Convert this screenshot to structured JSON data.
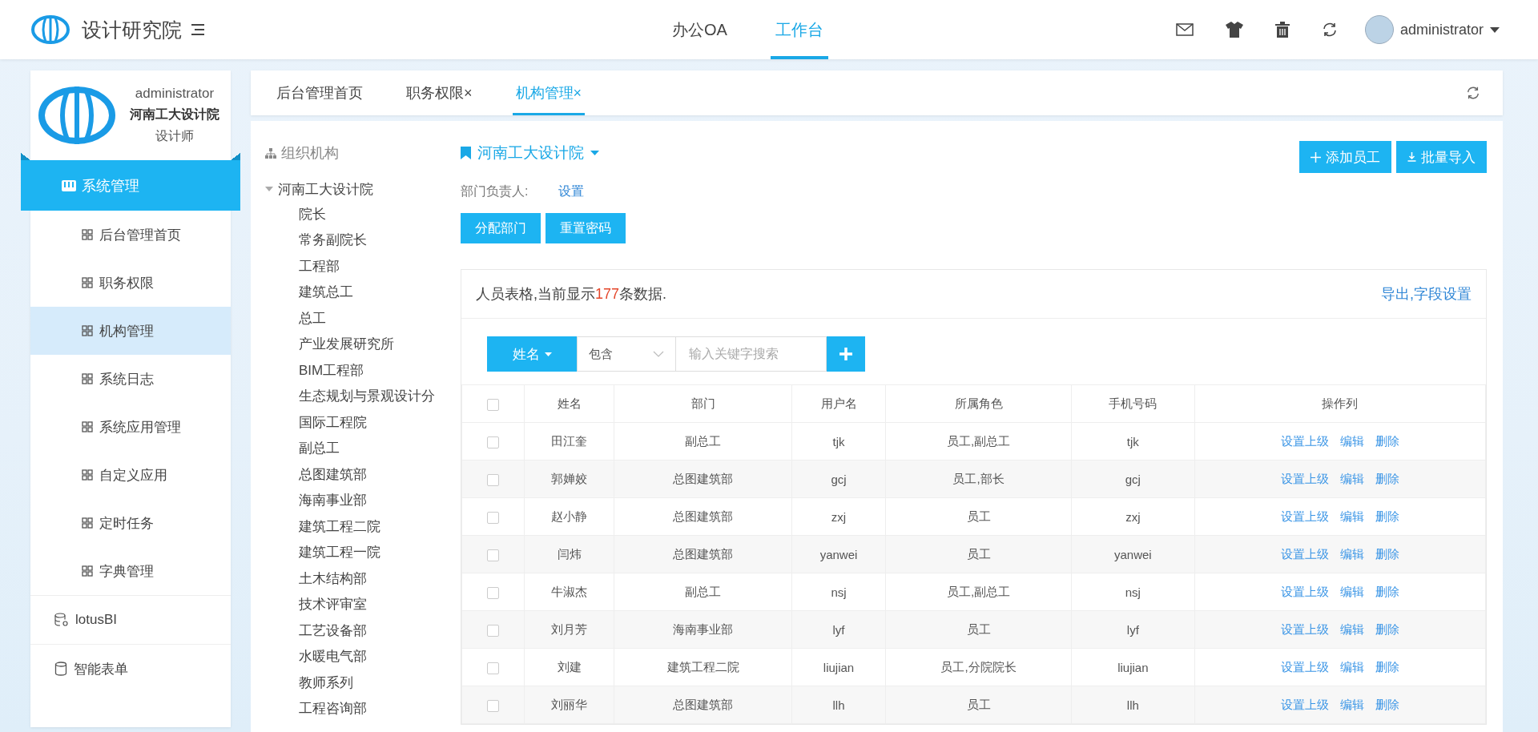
{
  "header": {
    "title": "设计研究院",
    "nav": [
      {
        "label": "办公OA",
        "selected": false
      },
      {
        "label": "工作台",
        "selected": true
      }
    ],
    "user": "administrator"
  },
  "sidebar": {
    "profile": {
      "name": "administrator",
      "org": "河南工大设计院",
      "role": "设计师"
    },
    "items": [
      {
        "label": "系统管理",
        "kind": "section",
        "selected": false
      },
      {
        "label": "后台管理首页",
        "kind": "item",
        "selected": false
      },
      {
        "label": "职务权限",
        "kind": "item",
        "selected": false
      },
      {
        "label": "机构管理",
        "kind": "item",
        "selected": true
      },
      {
        "label": "系统日志",
        "kind": "item",
        "selected": false
      },
      {
        "label": "系统应用管理",
        "kind": "item",
        "selected": false
      },
      {
        "label": "自定义应用",
        "kind": "item",
        "selected": false
      },
      {
        "label": "定时任务",
        "kind": "item",
        "selected": false
      },
      {
        "label": "字典管理",
        "kind": "item",
        "selected": false
      },
      {
        "label": "lotusBI",
        "kind": "db",
        "selected": false
      },
      {
        "label": "智能表单",
        "kind": "form",
        "selected": false
      }
    ]
  },
  "tabs": [
    {
      "label": "后台管理首页",
      "selected": false
    },
    {
      "label": "职务权限",
      "close": "×",
      "selected": false
    },
    {
      "label": "机构管理",
      "close": "×",
      "selected": true
    }
  ],
  "tree": {
    "title": "组织机构",
    "root": {
      "label": "河南工大设计院",
      "expanded": true,
      "children": [
        {
          "label": "院长"
        },
        {
          "label": "常务副院长"
        },
        {
          "label": "工程部"
        },
        {
          "label": "建筑总工"
        },
        {
          "label": "总工"
        },
        {
          "label": "产业发展研究所"
        },
        {
          "label": "BIM工程部"
        },
        {
          "label": "生态规划与景观设计分"
        },
        {
          "label": "国际工程院"
        },
        {
          "label": "副总工"
        },
        {
          "label": "总图建筑部"
        },
        {
          "label": "海南事业部"
        },
        {
          "label": "建筑工程二院"
        },
        {
          "label": "建筑工程一院"
        },
        {
          "label": "土木结构部"
        },
        {
          "label": "技术评审室"
        },
        {
          "label": "工艺设备部"
        },
        {
          "label": "水暖电气部"
        },
        {
          "label": "教师系列"
        },
        {
          "label": "工程咨询部"
        }
      ]
    }
  },
  "org": {
    "title": "河南工大设计院",
    "manager_label": "部门负责人:",
    "manager_action": "设置",
    "actions": [
      "分配部门",
      "重置密码"
    ],
    "top_buttons": [
      {
        "label": "添加员工",
        "kind": "add"
      },
      {
        "label": "批量导入",
        "kind": "import"
      }
    ]
  },
  "table": {
    "select_all_checked": false,
    "summary_prefix": "人员表格,当前显示",
    "count": "177",
    "summary_suffix": "条数据.",
    "links": "导出,字段设置",
    "filter": {
      "field": "姓名",
      "operator": "包含",
      "placeholder": "输入关键字搜索"
    },
    "columns": [
      "姓名",
      "部门",
      "用户名",
      "所属角色",
      "手机号码",
      "操作列"
    ],
    "rows": [
      {
        "checked": false,
        "cells": [
          "田江奎",
          "副总工",
          "tjk",
          "员工,副总工",
          "tjk"
        ],
        "actions": [
          "设置上级",
          "编辑",
          "删除"
        ]
      },
      {
        "checked": false,
        "cells": [
          "郭婵姣",
          "总图建筑部",
          "gcj",
          "员工,部长",
          "gcj"
        ],
        "actions": [
          "设置上级",
          "编辑",
          "删除"
        ]
      },
      {
        "checked": false,
        "cells": [
          "赵小静",
          "总图建筑部",
          "zxj",
          "员工",
          "zxj"
        ],
        "actions": [
          "设置上级",
          "编辑",
          "删除"
        ]
      },
      {
        "checked": false,
        "cells": [
          "闫炜",
          "总图建筑部",
          "yanwei",
          "员工",
          "yanwei"
        ],
        "actions": [
          "设置上级",
          "编辑",
          "删除"
        ]
      },
      {
        "checked": false,
        "cells": [
          "牛淑杰",
          "副总工",
          "nsj",
          "员工,副总工",
          "nsj"
        ],
        "actions": [
          "设置上级",
          "编辑",
          "删除"
        ]
      },
      {
        "checked": false,
        "cells": [
          "刘月芳",
          "海南事业部",
          "lyf",
          "员工",
          "lyf"
        ],
        "actions": [
          "设置上级",
          "编辑",
          "删除"
        ]
      },
      {
        "checked": false,
        "cells": [
          "刘建",
          "建筑工程二院",
          "liujian",
          "员工,分院院长",
          "liujian"
        ],
        "actions": [
          "设置上级",
          "编辑",
          "删除"
        ]
      },
      {
        "checked": false,
        "cells": [
          "刘丽华",
          "总图建筑部",
          "llh",
          "员工",
          "llh"
        ],
        "actions": [
          "设置上级",
          "编辑",
          "删除"
        ]
      }
    ]
  }
}
